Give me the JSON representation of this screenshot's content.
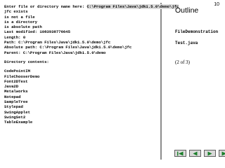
{
  "slide_number": "10",
  "output": {
    "prompt_label": "Enter file or directory name here: ",
    "prompt_value": "C:\\Program Files\\Java\\jdk1.5.0\\demo\\jfc",
    "info_lines": [
      "jfc exists",
      "is not a file",
      "is a directory",
      "is absolute path",
      "Last modified: 1083938776645",
      "Length: 0",
      "Path: C:\\Program Files\\Java\\jdk1.5.0\\demo\\jfc",
      "Absolute path: C:\\Program Files\\Java\\jdk1.5.0\\demo\\jfc",
      "Parent: C:\\Program Files\\Java\\jdk1.5.0\\demo"
    ],
    "contents_heading": "Directory contents:",
    "directory_entries": [
      "CodePointIM",
      "FileChooserDemo",
      "Font2DTest",
      "Java2D",
      "Metalworks",
      "Notepad",
      "SampleTree",
      "Stylepad",
      "SwingApplet",
      "SwingSet2",
      "TableExample"
    ]
  },
  "outline": {
    "title": "Outline",
    "items": [
      "FileDemonstration",
      "Test.java"
    ],
    "page_count": "(2 of 3)"
  },
  "nav": {
    "buttons": [
      "first-icon",
      "previous-icon",
      "next-icon",
      "last-icon"
    ]
  }
}
